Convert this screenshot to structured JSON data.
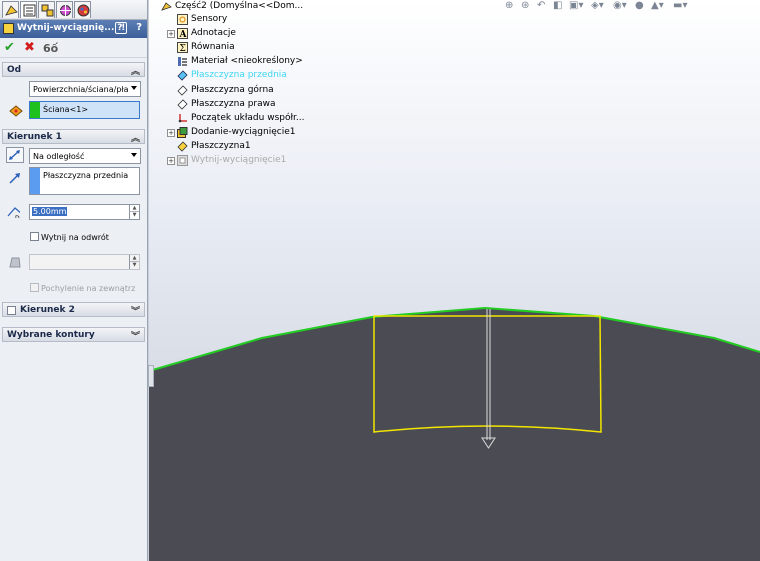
{
  "panel": {
    "title": "Wytnij-wyciągnię...",
    "help_label": "?",
    "ok_icon": "check-icon",
    "cancel_icon": "x-icon",
    "preview_icon": "glasses-icon",
    "tabs": [
      "feature-manager-icon",
      "property-manager-icon",
      "configuration-manager-icon",
      "dimxpert-icon",
      "display-manager-icon"
    ]
  },
  "from_group": {
    "title": "Od",
    "start_condition": "Powierzchnia/ściana/pła",
    "selection": "Ściana<1>",
    "selection_color": "#1ec11e"
  },
  "direction1_group": {
    "title": "Kierunek 1",
    "end_condition": "Na odległość",
    "reference": "Płaszczyzna przednia",
    "distance": "5.00mm",
    "distance_label": "D1",
    "flip_side": "Wytnij na odwrót",
    "draft_outward": "Pochylenie na zewnątrz"
  },
  "direction2_group": {
    "title": "Kierunek 2"
  },
  "contours_group": {
    "title": "Wybrane kontury"
  },
  "tree": {
    "root": "Część2  (Domyślna<<Dom...",
    "items": [
      "Sensory",
      "Adnotacje",
      "Równania",
      "Materiał <nieokreślony>",
      "Płaszczyzna przednia",
      "Płaszczyzna górna",
      "Płaszczyzna prawa",
      "Początek układu współr...",
      "Dodanie-wyciągnięcie1",
      "Płaszczyzna1",
      "Wytnij-wyciągnięcie1"
    ]
  },
  "colors": {
    "edge_highlight": "#22cc22",
    "sketch": "#f2e500",
    "part_body": "#4b4c53",
    "tree_highlight": "#3fd6f4",
    "title_bar": "#3c5f99"
  }
}
